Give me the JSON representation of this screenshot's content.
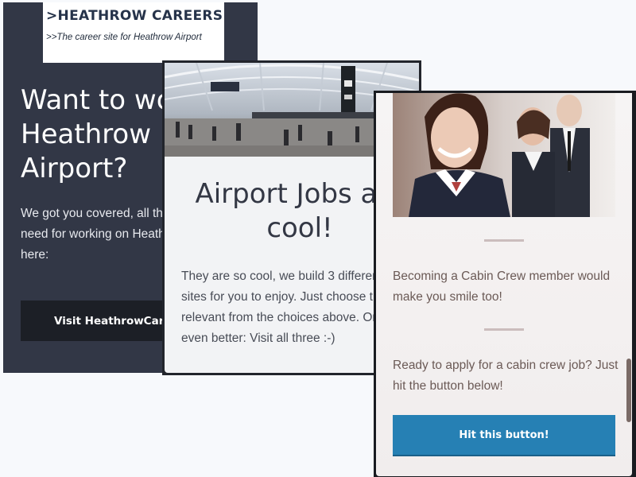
{
  "card_careers": {
    "logo_title": ">HEATHROW CAREERS",
    "logo_tagline": ">>The career site for Heathrow Airport",
    "heading": "Want to work on Heathrow Airport?",
    "body": "We got you covered, all the information you need for working on Heathrow Airport right here:",
    "button_label": "Visit HeathrowCareers"
  },
  "card_airport_jobs": {
    "heading_line1": "Airport Jobs are",
    "heading_line2": "cool!",
    "body": "They are so cool, we build 3 different\nsites for you to enjoy. Just choose the\nrelevant from the choices above. Or\neven better: Visit all three :-)"
  },
  "card_cabin_crew": {
    "smile_text": "Becoming a Cabin Crew member would make you smile too!",
    "apply_text": "Ready to apply for a cabin crew job? Just hit the button below!",
    "button_label": "Hit this button!"
  },
  "colors": {
    "dark_card": "#323746",
    "accent_button": "#2680b4"
  }
}
